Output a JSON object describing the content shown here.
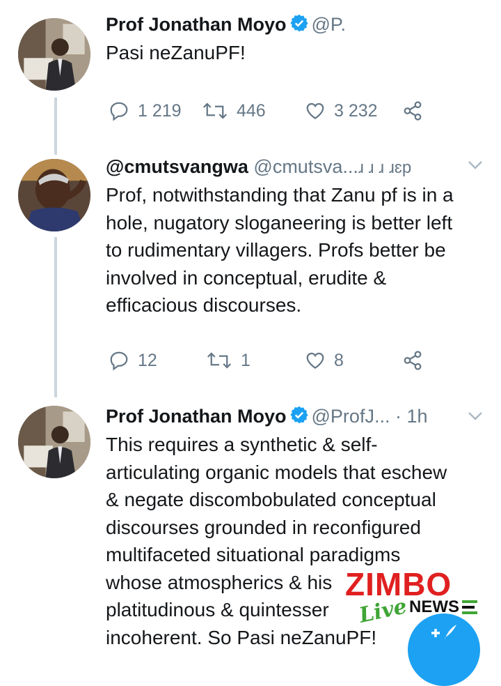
{
  "tweets": [
    {
      "name": "Prof Jonathan Moyo",
      "handle": "@P.",
      "time": "",
      "body": [
        "Pasi neZanuPF!"
      ],
      "replies": "1 219",
      "retweets": "446",
      "likes": "3 232"
    },
    {
      "name": "",
      "handle_bold": "@cmutsvangwa",
      "handle": "@cmutsva...",
      "time": "ɹ ɹ ɹ ɹɛp",
      "body": [
        "Prof, notwithstanding that Zanu pf is in a",
        "hole, nugatory sloganeering is better left",
        "to rudimentary villagers. Profs better be",
        "involved in  conceptual, erudite &",
        "efficacious discourses."
      ],
      "replies": "12",
      "retweets": "1",
      "likes": "8"
    },
    {
      "name": "Prof Jonathan Moyo",
      "handle": "@ProfJ...",
      "time": "· 1h",
      "body": [
        "This requires a synthetic & self-",
        "articulating organic models that eschew",
        "& negate discombobulated conceptual",
        "discourses grounded in reconfigured",
        "multifaceted situational paradigms",
        "whose atmospherics & his",
        "platitudinous & quintesser",
        "incoherent. So Pasi neZanuPF!"
      ]
    }
  ],
  "watermark": {
    "brand": "ZIMBO",
    "live": "Live",
    "news": "NEWS"
  },
  "icons": {
    "reply": "reply-icon",
    "retweet": "retweet-icon",
    "like": "heart-icon",
    "share": "share-icon",
    "verified": "verified-badge-icon",
    "more": "chevron-down-icon",
    "compose": "compose-tweet-icon"
  },
  "colors": {
    "verified": "#1da1f2",
    "muted": "#657786",
    "brand_red": "#e02020",
    "brand_green": "#3fa535"
  }
}
